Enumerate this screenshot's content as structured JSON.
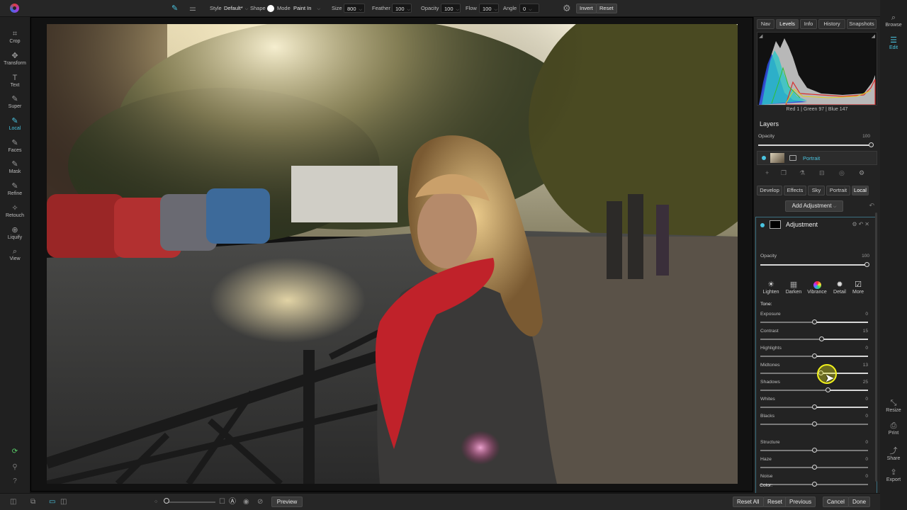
{
  "toolbar": {
    "style_label": "Style",
    "style_value": "Default*",
    "shape_label": "Shape",
    "mode_label": "Mode",
    "mode_value": "Paint In",
    "size_label": "Size",
    "size_value": "800",
    "feather_label": "Feather",
    "feather_value": "100",
    "opacity_label": "Opacity",
    "opacity_value": "100",
    "flow_label": "Flow",
    "flow_value": "100",
    "angle_label": "Angle",
    "angle_value": "0",
    "invert_label": "Invert",
    "reset_label": "Reset"
  },
  "left_tools": [
    {
      "label": "Crop",
      "icon": "crop-icon",
      "glyph": "⌗"
    },
    {
      "label": "Transform",
      "icon": "transform-icon",
      "glyph": "✥"
    },
    {
      "label": "Text",
      "icon": "text-icon",
      "glyph": "T"
    },
    {
      "label": "Super",
      "icon": "super-brush-icon",
      "glyph": "✎"
    },
    {
      "label": "Local",
      "icon": "local-brush-icon",
      "glyph": "✎"
    },
    {
      "label": "Faces",
      "icon": "faces-icon",
      "glyph": "✎"
    },
    {
      "label": "Mask",
      "icon": "mask-brush-icon",
      "glyph": "✎"
    },
    {
      "label": "Refine",
      "icon": "refine-brush-icon",
      "glyph": "✎"
    },
    {
      "label": "Retouch",
      "icon": "retouch-icon",
      "glyph": "✧"
    },
    {
      "label": "Liquify",
      "icon": "liquify-icon",
      "glyph": "⊕"
    },
    {
      "label": "View",
      "icon": "view-icon",
      "glyph": "⌕"
    }
  ],
  "right_tabs": [
    "Nav",
    "Levels",
    "Info",
    "History",
    "Snapshots"
  ],
  "histogram": {
    "readout": "Red   1   | Green  97   | Blue 147"
  },
  "layers": {
    "title": "Layers",
    "opacity_label": "Opacity",
    "opacity_value": "100",
    "layer_name": "Portrait"
  },
  "module_tabs": [
    "Develop",
    "Effects",
    "Sky",
    "Portrait",
    "Local"
  ],
  "add_adjustment": "Add Adjustment",
  "adjustment": {
    "title": "Adjustment",
    "opacity_label": "Opacity",
    "opacity_value": "100",
    "filters": [
      {
        "label": "Lighten",
        "glyph": "☀"
      },
      {
        "label": "Darken",
        "glyph": "⚃"
      },
      {
        "label": "Vibrance",
        "glyph": ""
      },
      {
        "label": "Detail",
        "glyph": "✹"
      },
      {
        "label": "More",
        "glyph": "☑"
      }
    ],
    "tone_label": "Tone:",
    "tone": [
      {
        "label": "Exposure",
        "value": "0"
      },
      {
        "label": "Contrast",
        "value": "15"
      },
      {
        "label": "Highlights",
        "value": "0"
      },
      {
        "label": "Midtones",
        "value": "13"
      },
      {
        "label": "Shadows",
        "value": "25"
      },
      {
        "label": "Whites",
        "value": "0"
      },
      {
        "label": "Blacks",
        "value": "0"
      }
    ],
    "other": [
      {
        "label": "Structure",
        "value": "0"
      },
      {
        "label": "Haze",
        "value": "0"
      },
      {
        "label": "Noise",
        "value": "0"
      }
    ],
    "color_label": "Color:"
  },
  "far_right": {
    "browse": "Browse",
    "edit": "Edit",
    "resize": "Resize",
    "print": "Print",
    "share": "Share",
    "export": "Export"
  },
  "bottom": {
    "preview": "Preview",
    "reset_all": "Reset All",
    "reset": "Reset",
    "previous": "Previous",
    "cancel": "Cancel",
    "done": "Done"
  },
  "colors": {
    "accent": "#4ac4e0",
    "cursor_highlight": "#f2f21c"
  }
}
